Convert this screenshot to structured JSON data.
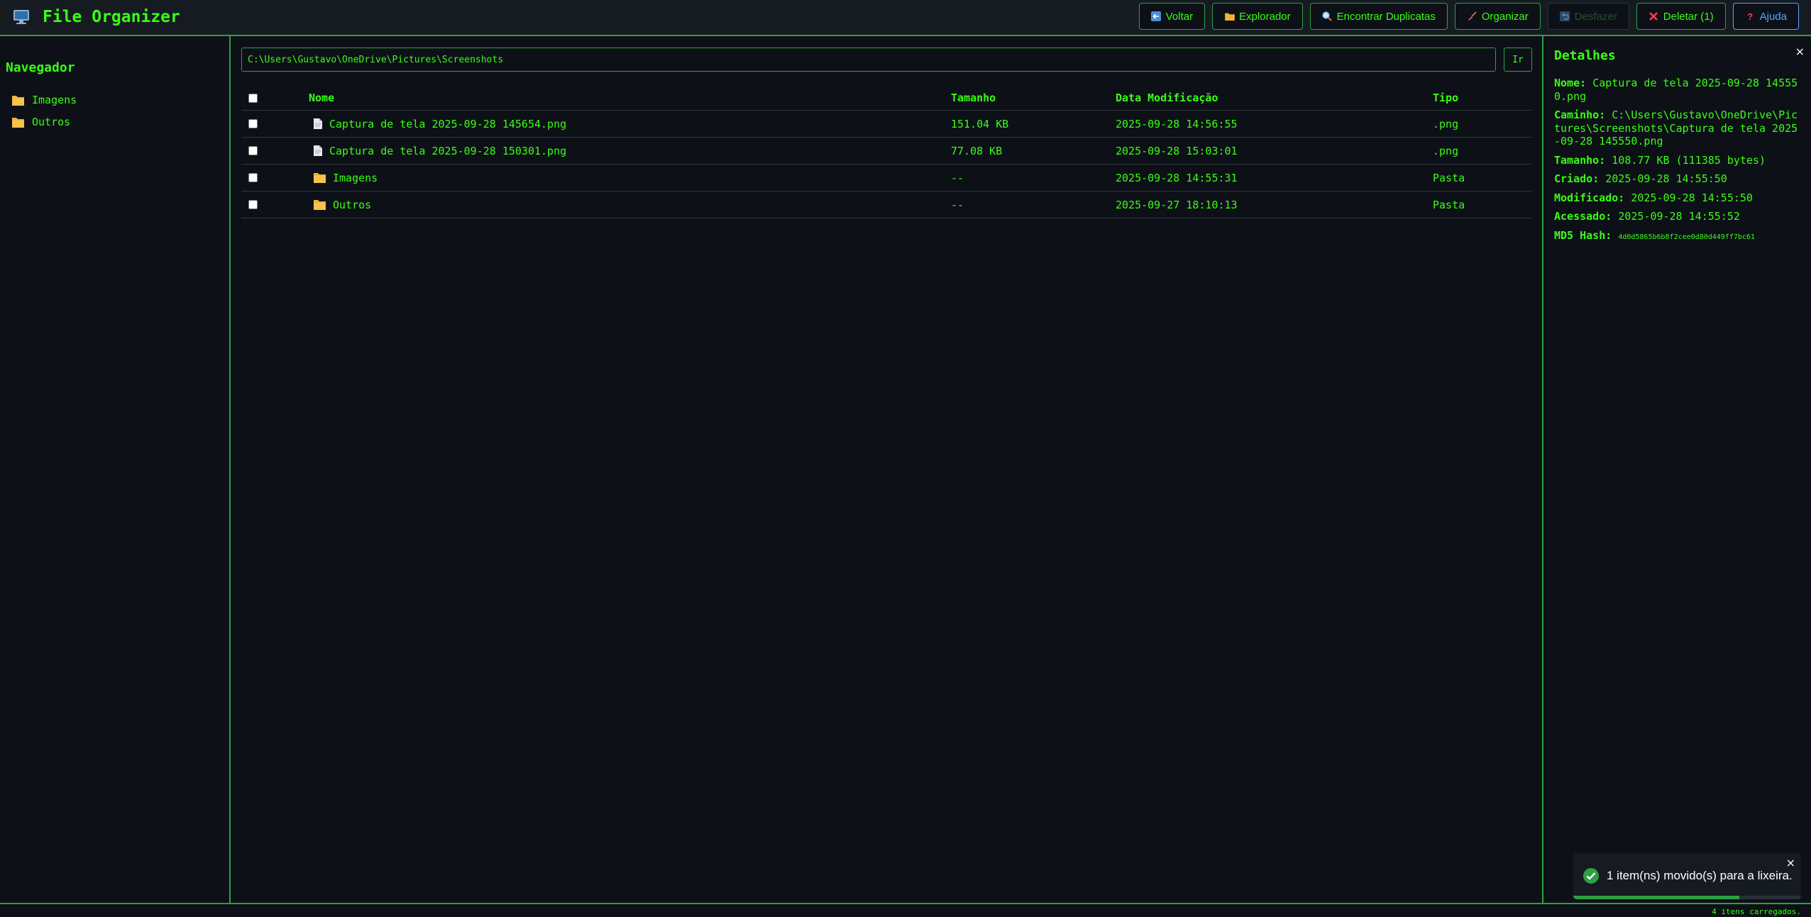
{
  "app": {
    "title": "File Organizer",
    "icon": "computer-icon"
  },
  "toolbar": {
    "back_label": "Voltar",
    "explorer_label": "Explorador",
    "duplicates_label": "Encontrar Duplicatas",
    "organize_label": "Organizar",
    "undo_label": "Desfazer",
    "delete_label": "Deletar (1)",
    "help_label": "Ajuda"
  },
  "sidebar": {
    "title": "Navegador",
    "items": [
      {
        "label": "Imagens",
        "icon": "folder-icon"
      },
      {
        "label": "Outros",
        "icon": "folder-icon"
      }
    ]
  },
  "path": {
    "value": "C:\\Users\\Gustavo\\OneDrive\\Pictures\\Screenshots",
    "go_label": "Ir"
  },
  "table": {
    "headers": {
      "name": "Nome",
      "size": "Tamanho",
      "date": "Data Modificação",
      "type": "Tipo"
    },
    "rows": [
      {
        "name": "Captura de tela 2025-09-28 145654.png",
        "size": "151.04 KB",
        "date": "2025-09-28 14:56:55",
        "type": ".png",
        "icon": "file-icon"
      },
      {
        "name": "Captura de tela 2025-09-28 150301.png",
        "size": "77.08 KB",
        "date": "2025-09-28 15:03:01",
        "type": ".png",
        "icon": "file-icon"
      },
      {
        "name": "Imagens",
        "size": "--",
        "date": "2025-09-28 14:55:31",
        "type": "Pasta",
        "icon": "folder-icon"
      },
      {
        "name": "Outros",
        "size": "--",
        "date": "2025-09-27 18:10:13",
        "type": "Pasta",
        "icon": "folder-icon"
      }
    ]
  },
  "details": {
    "title": "Detalhes",
    "close": "×",
    "name_label": "Nome:",
    "name_value": "Captura de tela 2025-09-28 145550.png",
    "path_label": "Caminho:",
    "path_value": "C:\\Users\\Gustavo\\OneDrive\\Pictures\\Screenshots\\Captura de tela 2025-09-28 145550.png",
    "size_label": "Tamanho:",
    "size_value": "108.77 KB (111385 bytes)",
    "created_label": "Criado:",
    "created_value": "2025-09-28 14:55:50",
    "modified_label": "Modificado:",
    "modified_value": "2025-09-28 14:55:50",
    "accessed_label": "Acessado:",
    "accessed_value": "2025-09-28 14:55:52",
    "hash_label": "MD5 Hash:",
    "hash_value": "4d0d5865b6b8f2cee0d80d449ff7bc61"
  },
  "status": {
    "text": "4 itens carregados."
  },
  "toast": {
    "message": "1 item(ns) movido(s) para a lixeira.",
    "close": "×",
    "progress": 0.73
  },
  "colors": {
    "accent": "#39ff14",
    "border": "#2ea043",
    "background": "#0d1117",
    "panel": "#161b22",
    "folder": "#f0b43c",
    "help": "#58a6ff"
  }
}
